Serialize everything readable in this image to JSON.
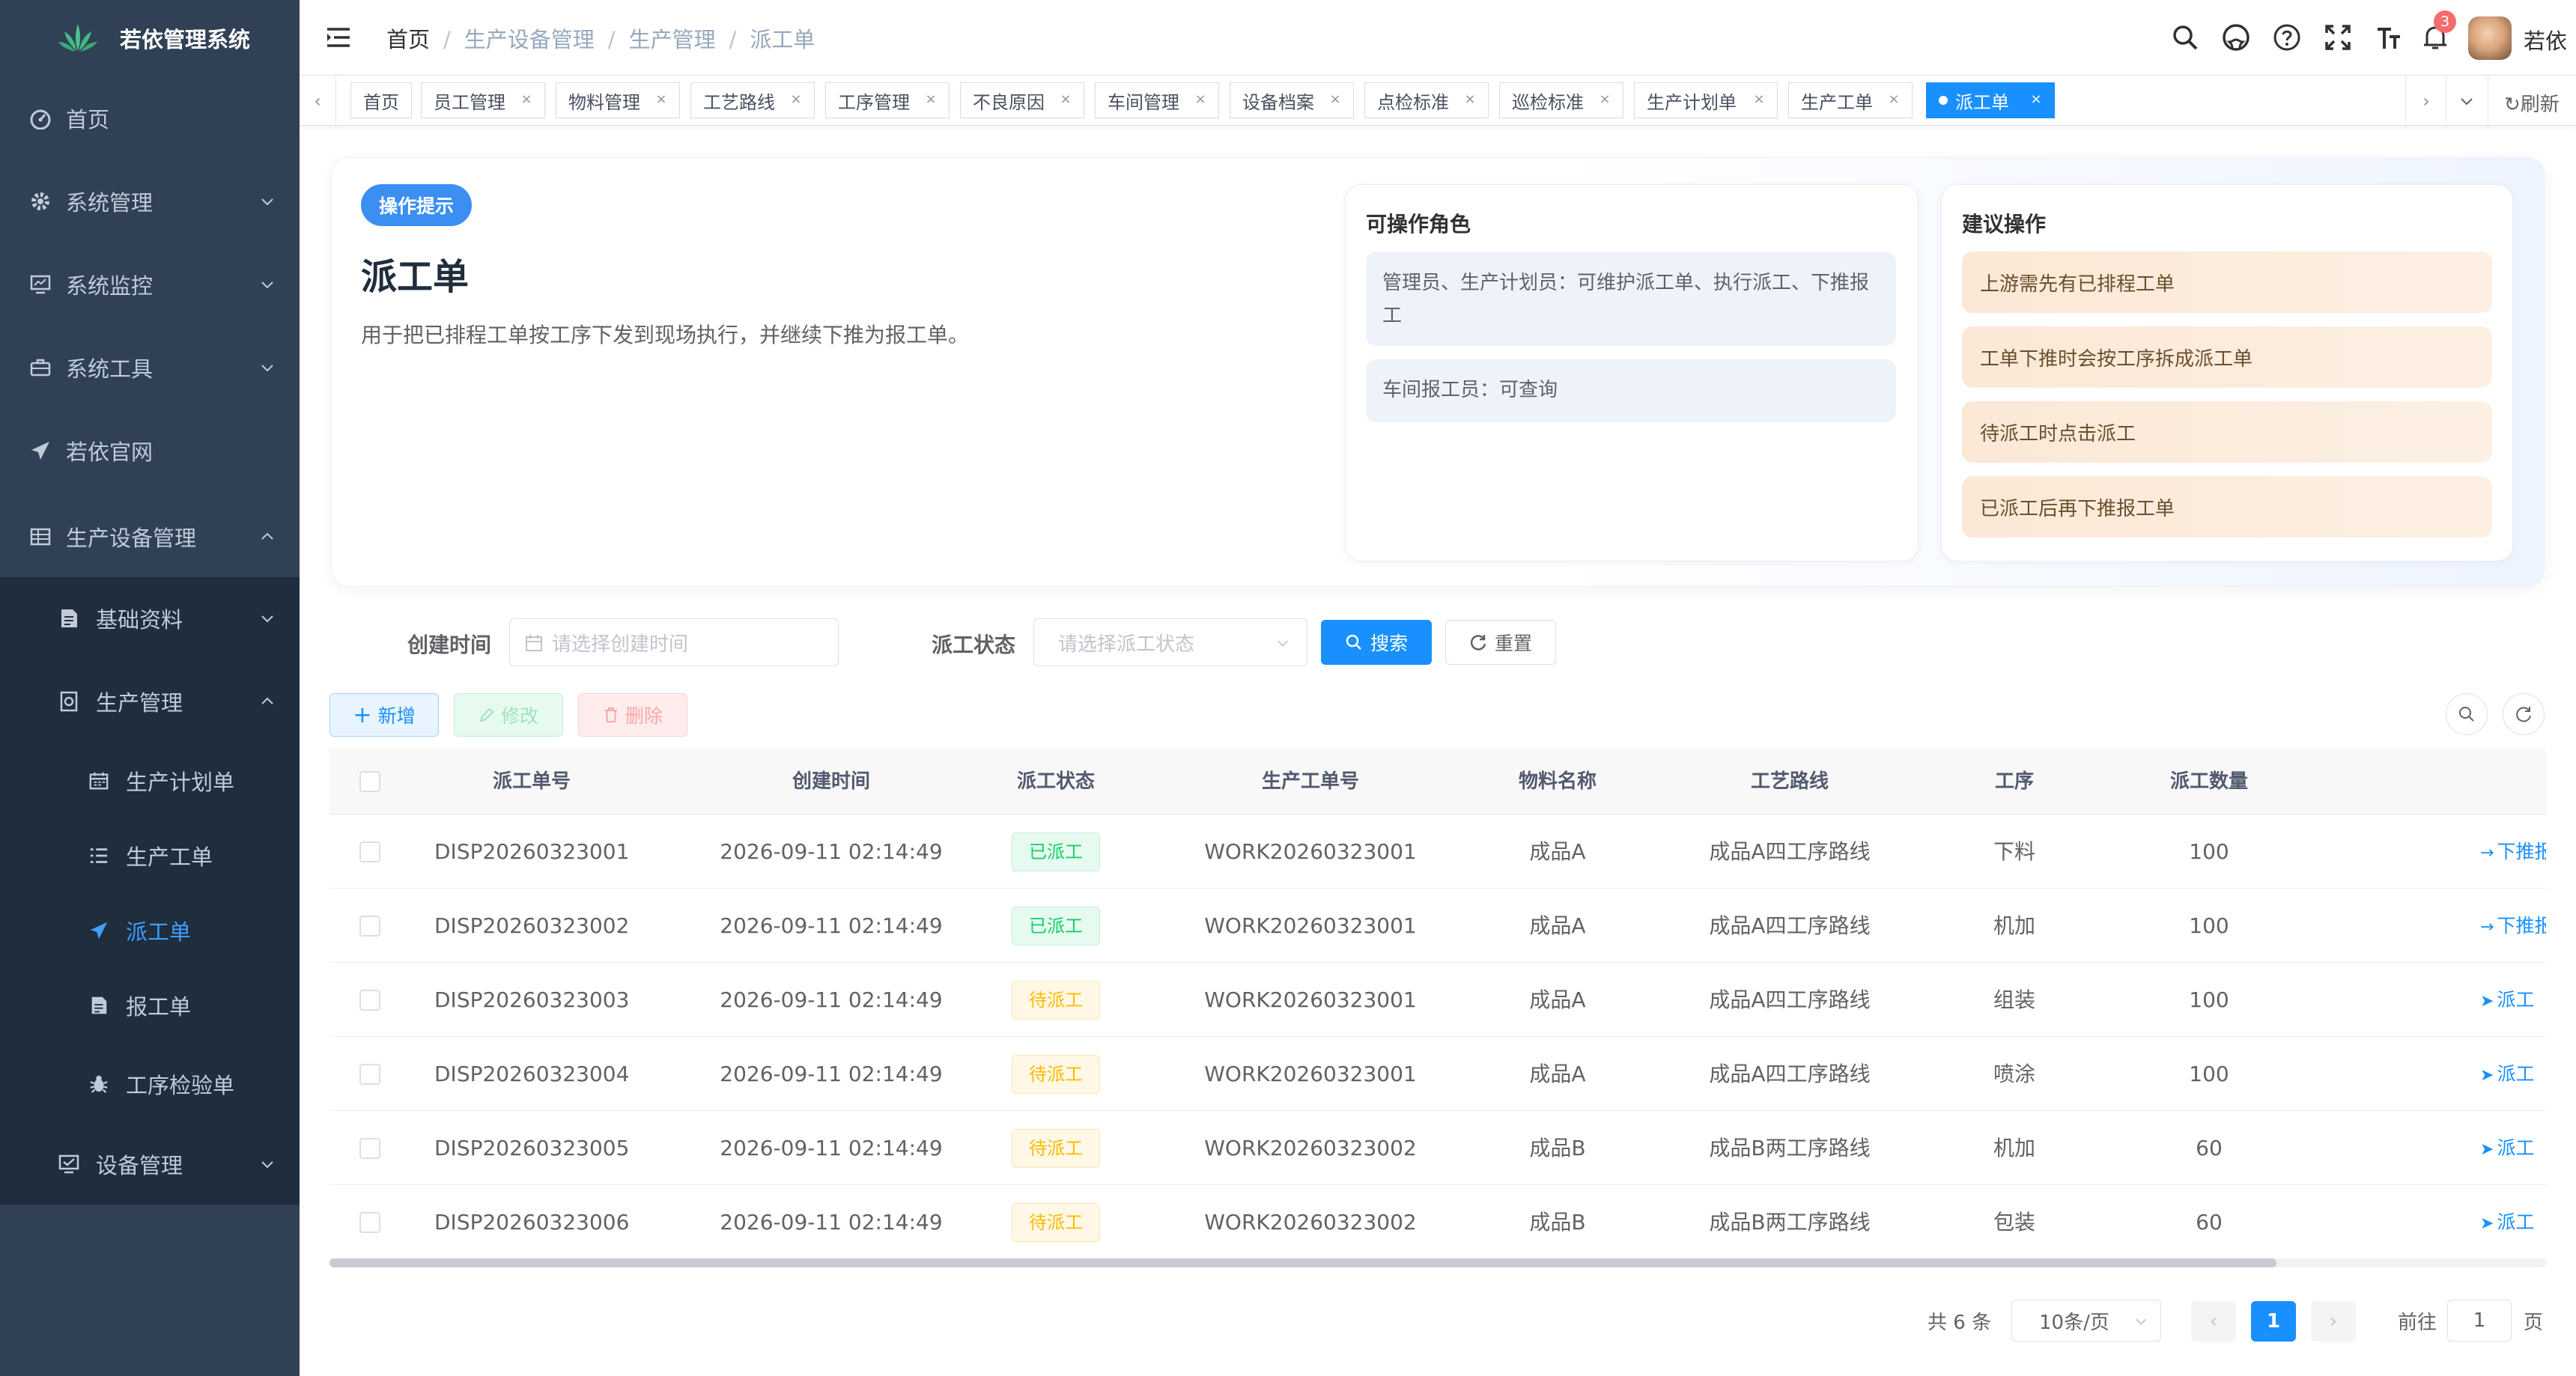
{
  "app": {
    "title": "若依管理系统",
    "user": "若依",
    "notification_count": "3"
  },
  "sidebar": {
    "items": [
      {
        "label": "首页",
        "icon": "dashboard-icon"
      },
      {
        "label": "系统管理",
        "icon": "gear-icon"
      },
      {
        "label": "系统监控",
        "icon": "monitor-icon"
      },
      {
        "label": "系统工具",
        "icon": "toolbox-icon"
      },
      {
        "label": "若依官网",
        "icon": "paper-plane-icon"
      },
      {
        "label": "生产设备管理",
        "icon": "grid-icon"
      },
      {
        "label": "基础资料",
        "icon": "document-icon"
      },
      {
        "label": "生产管理",
        "icon": "box-icon"
      },
      {
        "label": "生产计划单",
        "icon": "calendar-icon"
      },
      {
        "label": "生产工单",
        "icon": "list-icon"
      },
      {
        "label": "派工单",
        "icon": "paper-plane-icon"
      },
      {
        "label": "报工单",
        "icon": "report-icon"
      },
      {
        "label": "工序检验单",
        "icon": "bug-icon"
      },
      {
        "label": "设备管理",
        "icon": "equipment-icon"
      }
    ],
    "active_color": "#409eff"
  },
  "breadcrumb": [
    "首页",
    "生产设备管理",
    "生产管理",
    "派工单"
  ],
  "tags": [
    "首页",
    "员工管理",
    "物料管理",
    "工艺路线",
    "工序管理",
    "不良原因",
    "车间管理",
    "设备档案",
    "点检标准",
    "巡检标准",
    "生产计划单",
    "生产工单",
    "派工单"
  ],
  "tags_refresh": "刷新",
  "tip": {
    "badge": "操作提示",
    "title": "派工单",
    "desc": "用于把已排程工单按工序下发到现场执行，并继续下推为报工单。",
    "roles_title": "可操作角色",
    "roles": [
      "管理员、生产计划员：可维护派工单、执行派工、下推报工",
      "车间报工员：可查询"
    ],
    "suggest_title": "建议操作",
    "suggestions": [
      "上游需先有已排程工单",
      "工单下推时会按工序拆成派工单",
      "待派工时点击派工",
      "已派工后再下推报工单"
    ]
  },
  "search": {
    "created_label": "创建时间",
    "created_placeholder": "请选择创建时间",
    "status_label": "派工状态",
    "status_placeholder": "请选择派工状态",
    "search_btn": "搜索",
    "reset_btn": "重置"
  },
  "toolbar": {
    "add": "新增",
    "edit": "修改",
    "delete": "删除"
  },
  "table": {
    "columns": [
      "派工单号",
      "创建时间",
      "派工状态",
      "生产工单号",
      "物料名称",
      "工艺路线",
      "工序",
      "派工数量"
    ],
    "rows": [
      {
        "no": "DISP20260323001",
        "time": "2026-09-11 02:14:49",
        "status": "已派工",
        "status_type": "done",
        "work": "WORK20260323001",
        "material": "成品A",
        "route": "成品A四工序路线",
        "process": "下料",
        "qty": "100",
        "op": "下推报"
      },
      {
        "no": "DISP20260323002",
        "time": "2026-09-11 02:14:49",
        "status": "已派工",
        "status_type": "done",
        "work": "WORK20260323001",
        "material": "成品A",
        "route": "成品A四工序路线",
        "process": "机加",
        "qty": "100",
        "op": "下推报"
      },
      {
        "no": "DISP20260323003",
        "time": "2026-09-11 02:14:49",
        "status": "待派工",
        "status_type": "wait",
        "work": "WORK20260323001",
        "material": "成品A",
        "route": "成品A四工序路线",
        "process": "组装",
        "qty": "100",
        "op": "派工"
      },
      {
        "no": "DISP20260323004",
        "time": "2026-09-11 02:14:49",
        "status": "待派工",
        "status_type": "wait",
        "work": "WORK20260323001",
        "material": "成品A",
        "route": "成品A四工序路线",
        "process": "喷涂",
        "qty": "100",
        "op": "派工"
      },
      {
        "no": "DISP20260323005",
        "time": "2026-09-11 02:14:49",
        "status": "待派工",
        "status_type": "wait",
        "work": "WORK20260323002",
        "material": "成品B",
        "route": "成品B两工序路线",
        "process": "机加",
        "qty": "60",
        "op": "派工"
      },
      {
        "no": "DISP20260323006",
        "time": "2026-09-11 02:14:49",
        "status": "待派工",
        "status_type": "wait",
        "work": "WORK20260323002",
        "material": "成品B",
        "route": "成品B两工序路线",
        "process": "包装",
        "qty": "60",
        "op": "派工"
      }
    ]
  },
  "pagination": {
    "total": "共 6 条",
    "page_size": "10条/页",
    "current": "1",
    "goto_prefix": "前往",
    "goto_value": "1",
    "goto_suffix": "页"
  }
}
